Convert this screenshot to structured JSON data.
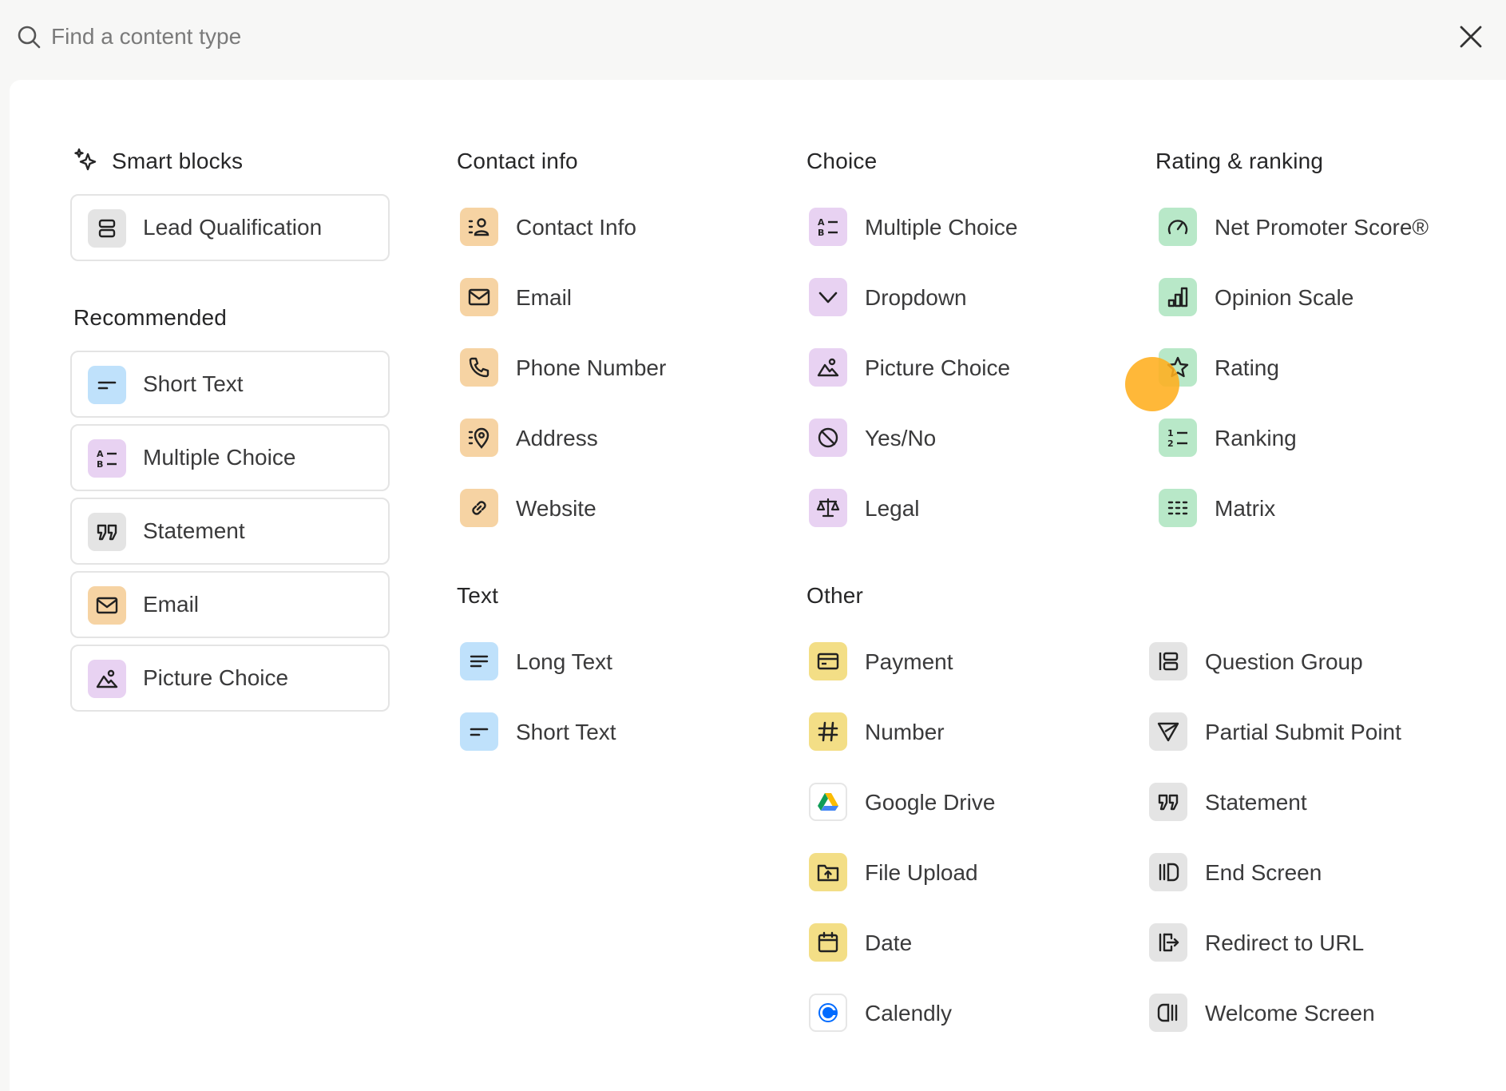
{
  "search": {
    "placeholder": "Find a content type",
    "value": ""
  },
  "sections": {
    "smart_blocks": "Smart blocks",
    "recommended": "Recommended",
    "contact_info": "Contact info",
    "choice": "Choice",
    "rating_ranking": "Rating & ranking",
    "text": "Text",
    "other": "Other"
  },
  "smart_blocks": [
    {
      "label": "Lead Qualification",
      "icon": "lead-qualification-icon",
      "color": "#e4e4e4"
    }
  ],
  "recommended": [
    {
      "label": "Short Text",
      "icon": "short-text-icon",
      "color": "#bfe1fb"
    },
    {
      "label": "Multiple Choice",
      "icon": "multiple-choice-icon",
      "color": "#e8d2f2"
    },
    {
      "label": "Statement",
      "icon": "quote-icon",
      "color": "#e4e4e4"
    },
    {
      "label": "Email",
      "icon": "mail-icon",
      "color": "#f6d3a3"
    },
    {
      "label": "Picture Choice",
      "icon": "picture-icon",
      "color": "#e8d2f2"
    }
  ],
  "contact_info": [
    {
      "label": "Contact Info",
      "icon": "contact-info-icon"
    },
    {
      "label": "Email",
      "icon": "mail-icon"
    },
    {
      "label": "Phone Number",
      "icon": "phone-icon"
    },
    {
      "label": "Address",
      "icon": "address-pin-icon"
    },
    {
      "label": "Website",
      "icon": "link-icon"
    }
  ],
  "choice": [
    {
      "label": "Multiple Choice",
      "icon": "multiple-choice-icon"
    },
    {
      "label": "Dropdown",
      "icon": "chevron-down-icon"
    },
    {
      "label": "Picture Choice",
      "icon": "picture-icon"
    },
    {
      "label": "Yes/No",
      "icon": "yes-no-icon"
    },
    {
      "label": "Legal",
      "icon": "scales-icon"
    }
  ],
  "rating_ranking": [
    {
      "label": "Net Promoter Score®",
      "icon": "gauge-icon"
    },
    {
      "label": "Opinion Scale",
      "icon": "bar-chart-icon"
    },
    {
      "label": "Rating",
      "icon": "star-icon"
    },
    {
      "label": "Ranking",
      "icon": "ranking-icon"
    },
    {
      "label": "Matrix",
      "icon": "matrix-icon"
    }
  ],
  "text": [
    {
      "label": "Long Text",
      "icon": "long-text-icon"
    },
    {
      "label": "Short Text",
      "icon": "short-text-icon"
    }
  ],
  "other_left": [
    {
      "label": "Payment",
      "icon": "credit-card-icon"
    },
    {
      "label": "Number",
      "icon": "hash-icon"
    },
    {
      "label": "Google Drive",
      "icon": "google-drive-icon"
    },
    {
      "label": "File Upload",
      "icon": "folder-upload-icon"
    },
    {
      "label": "Date",
      "icon": "calendar-icon"
    },
    {
      "label": "Calendly",
      "icon": "calendly-icon"
    }
  ],
  "other_right": [
    {
      "label": "Question Group",
      "icon": "question-group-icon"
    },
    {
      "label": "Partial Submit Point",
      "icon": "send-icon"
    },
    {
      "label": "Statement",
      "icon": "quote-icon"
    },
    {
      "label": "End Screen",
      "icon": "end-screen-icon"
    },
    {
      "label": "Redirect to URL",
      "icon": "redirect-icon"
    },
    {
      "label": "Welcome Screen",
      "icon": "welcome-screen-icon"
    }
  ],
  "colors": {
    "contact": "#f6d3a3",
    "choice": "#e8d2f2",
    "rating": "#b8e8c8",
    "text": "#bfe1fb",
    "other": "#f3de86",
    "neutral": "#e4e4e4",
    "cursor": "#ffae1e"
  }
}
